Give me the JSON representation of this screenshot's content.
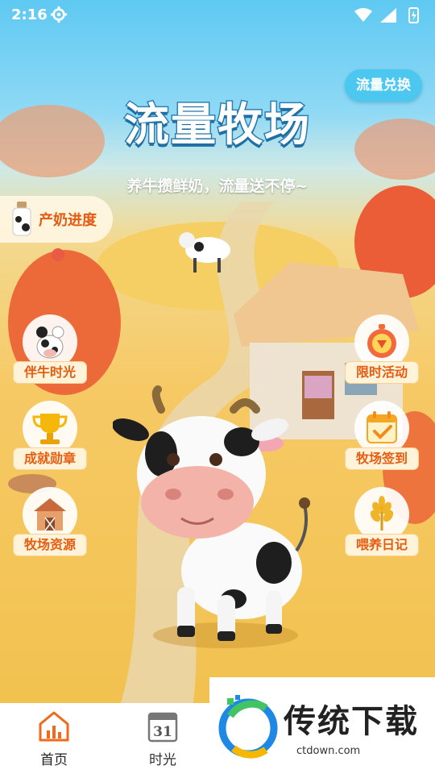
{
  "status_bar": {
    "time": "2:16"
  },
  "header": {
    "exchange_label": "流量兑换",
    "title": "流量牧场",
    "subtitle": "养牛攒鲜奶，流量送不停~"
  },
  "progress": {
    "label": "产奶进度"
  },
  "left_menu": [
    {
      "label": "伴牛时光",
      "icon": "cow-icon"
    },
    {
      "label": "成就勋章",
      "icon": "trophy-icon"
    },
    {
      "label": "牧场资源",
      "icon": "barn-icon"
    }
  ],
  "right_menu": [
    {
      "label": "限时活动",
      "icon": "timer-icon"
    },
    {
      "label": "牧场签到",
      "icon": "calendar-check-icon"
    },
    {
      "label": "喂养日记",
      "icon": "wheat-icon"
    }
  ],
  "tabs": [
    {
      "label": "首页",
      "icon": "home-chart-icon",
      "active": true
    },
    {
      "label": "时光",
      "icon": "calendar-31-icon",
      "active": false
    }
  ],
  "calendar_icon_day": "31",
  "watermark": {
    "text": "传统下载",
    "url": "ctdown.com"
  },
  "colors": {
    "accent": "#e65c10",
    "sky": "#5fc9f2",
    "exchange_btn": "#4cc7f0",
    "active_tab": "#ef6a1a"
  }
}
